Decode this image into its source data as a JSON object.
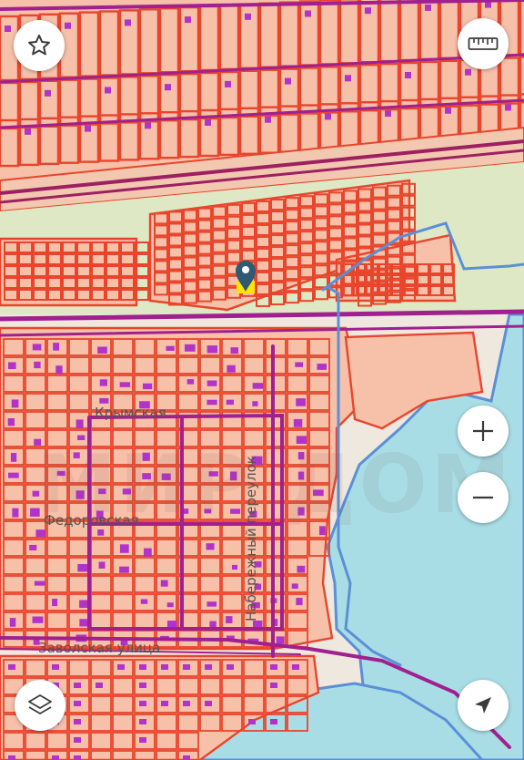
{
  "map": {
    "streets": [
      {
        "id": "krymskaya",
        "label": "Крымская"
      },
      {
        "id": "fedorovskaya",
        "label": "Федоровская"
      },
      {
        "id": "naberezhny",
        "label": "Набережный переулок"
      },
      {
        "id": "zavolskaya",
        "label": "Заволская улица"
      }
    ],
    "watermark": "МИР ДОМ",
    "marker": {
      "icon": "location-pin-icon",
      "color": "#2f5a72",
      "highlight": "#ffe600"
    }
  },
  "controls": {
    "favorite": {
      "icon": "star-icon"
    },
    "ruler": {
      "icon": "ruler-icon"
    },
    "zoom_in": {
      "icon": "plus-icon"
    },
    "zoom_out": {
      "icon": "minus-icon"
    },
    "layers": {
      "icon": "layers-icon"
    },
    "locate": {
      "icon": "navigation-arrow-icon"
    }
  },
  "colors": {
    "parcel_fill": "#f6c0a9",
    "parcel_stroke": "#e8452c",
    "boundary": "#a0208f",
    "water": "#a9dde6",
    "water_edge": "#5b8fd6",
    "green_area": "#dfe8c4",
    "building": "#b233c7"
  }
}
